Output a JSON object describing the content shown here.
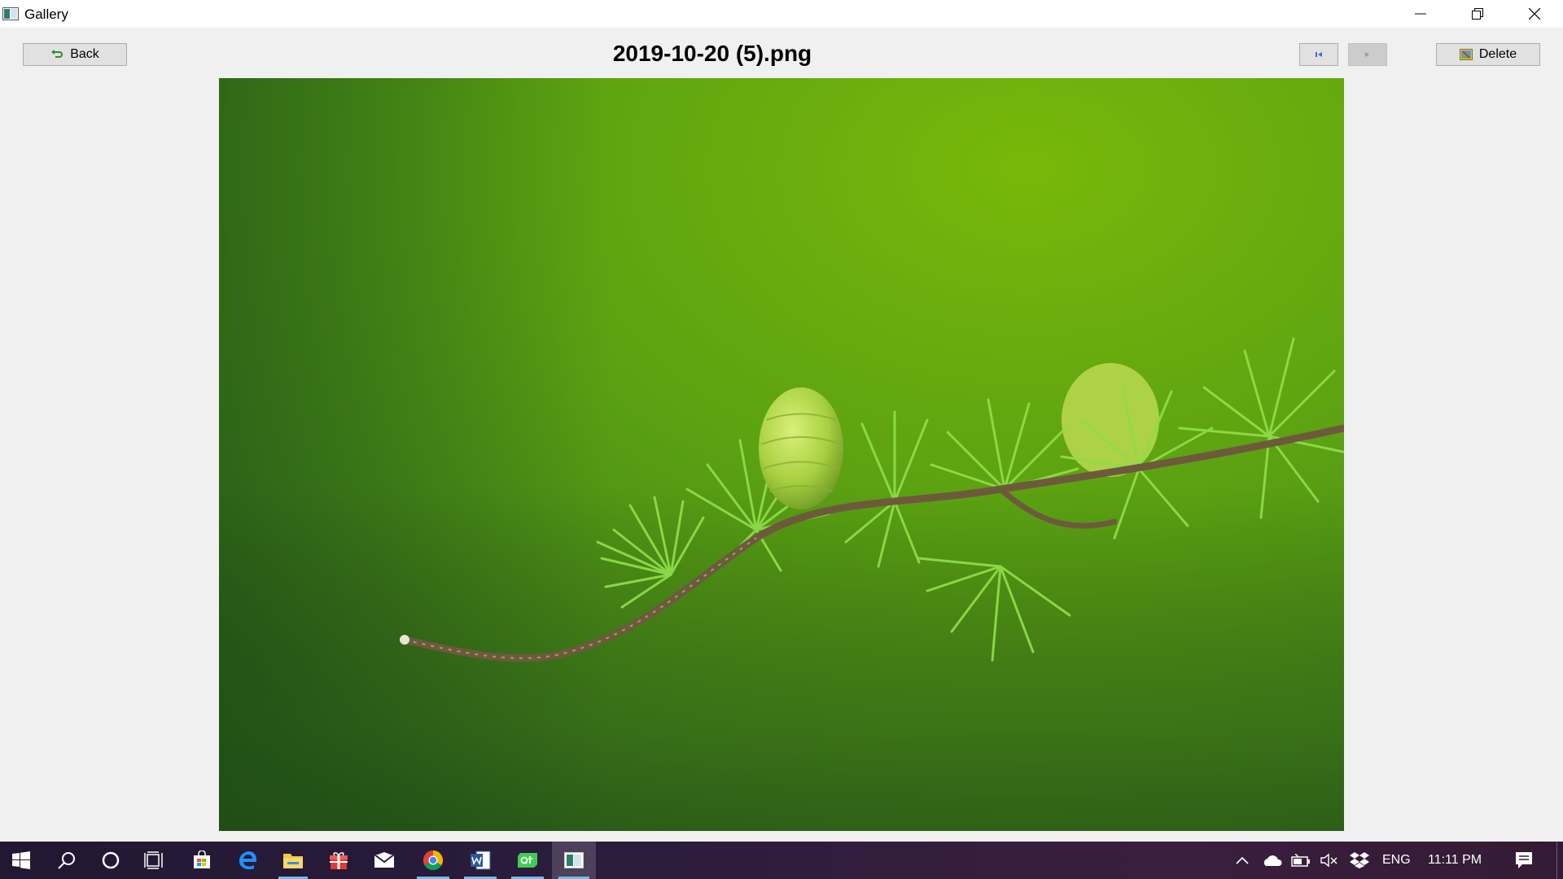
{
  "window": {
    "title": "Gallery",
    "icons": [
      "gallery-app-icon",
      "minimize-icon",
      "restore-icon",
      "close-icon"
    ]
  },
  "toolbar": {
    "back_label": "Back",
    "delete_label": "Delete",
    "file_name": "2019-10-20 (5).png",
    "icons": [
      "back-arrow-icon",
      "prev-icon",
      "next-icon",
      "delete-icon"
    ]
  },
  "viewer": {
    "image_subject": "green larch branch with cones",
    "colors": {
      "background": "#4e9a10",
      "needles": "#8cd64a",
      "cone": "#b6db52",
      "branch": "#6d5a3d"
    }
  },
  "taskbar": {
    "apps": [
      "windows-start-icon",
      "search-icon",
      "cortana-icon",
      "task-view-icon",
      "store-icon",
      "edge-icon",
      "file-explorer-icon",
      "gift-icon",
      "mail-icon",
      "chrome-icon",
      "word-icon",
      "qt-icon",
      "gallery-app-icon"
    ],
    "tray": {
      "language": "ENG",
      "time": "11:11 PM",
      "icons": [
        "chevron-up-icon",
        "onedrive-icon",
        "battery-icon",
        "volume-muted-icon",
        "dropbox-icon",
        "notification-icon"
      ]
    }
  },
  "colors": {
    "window_bg": "#f0f0f0",
    "button_bg": "#e1e1e1",
    "taskbar_bg": "#2b1c3c",
    "accent": "#76b9ed"
  }
}
